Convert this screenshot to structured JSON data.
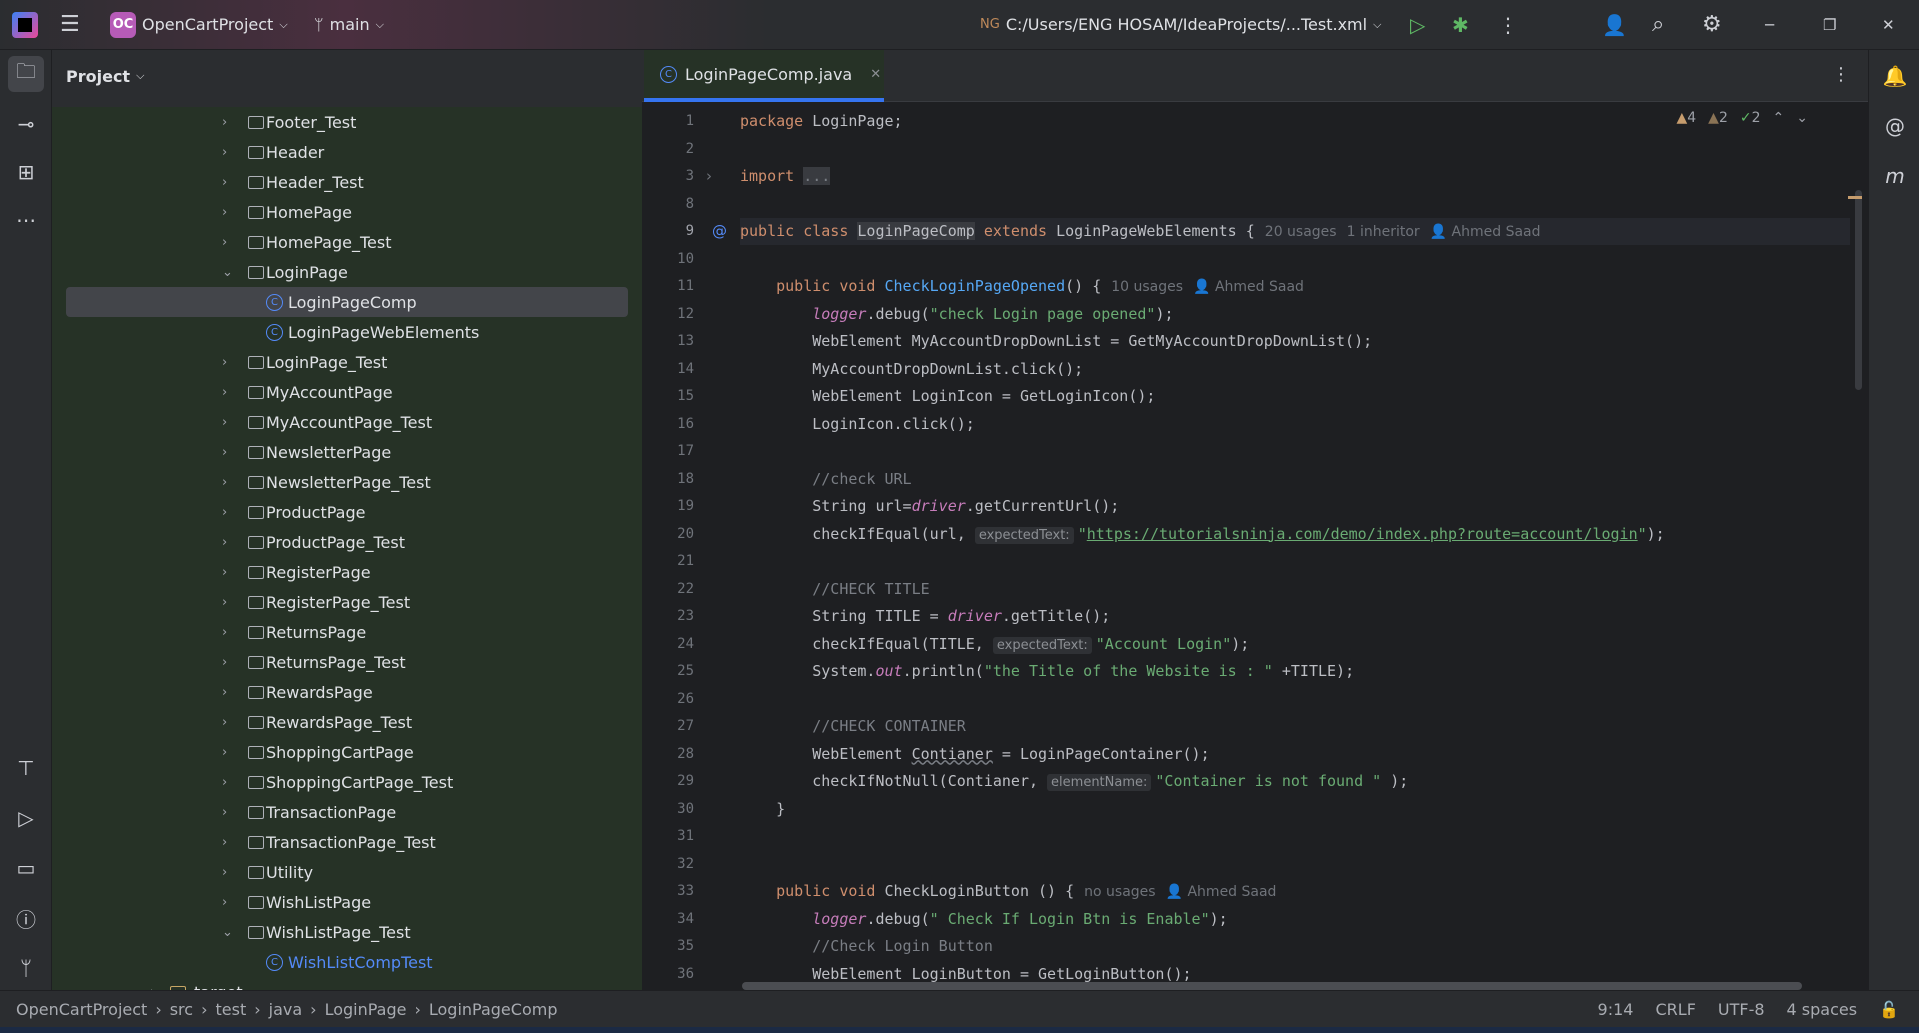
{
  "titlebar": {
    "project_badge": "OC",
    "project": "OpenCartProject",
    "branch": "main",
    "run_config": "C:/Users/ENG HOSAM/IdeaProjects/...Test.xml"
  },
  "project_panel": {
    "title": "Project",
    "items": [
      {
        "label": "Footer_Test",
        "type": "folder",
        "level": 1,
        "expanded": false
      },
      {
        "label": "Header",
        "type": "folder",
        "level": 1,
        "expanded": false
      },
      {
        "label": "Header_Test",
        "type": "folder",
        "level": 1,
        "expanded": false
      },
      {
        "label": "HomePage",
        "type": "folder",
        "level": 1,
        "expanded": false
      },
      {
        "label": "HomePage_Test",
        "type": "folder",
        "level": 1,
        "expanded": false
      },
      {
        "label": "LoginPage",
        "type": "folder",
        "level": 1,
        "expanded": true
      },
      {
        "label": "LoginPageComp",
        "type": "class",
        "level": 2,
        "selected": true
      },
      {
        "label": "LoginPageWebElements",
        "type": "class",
        "level": 2
      },
      {
        "label": "LoginPage_Test",
        "type": "folder",
        "level": 1,
        "expanded": false
      },
      {
        "label": "MyAccountPage",
        "type": "folder",
        "level": 1,
        "expanded": false
      },
      {
        "label": "MyAccountPage_Test",
        "type": "folder",
        "level": 1,
        "expanded": false
      },
      {
        "label": "NewsletterPage",
        "type": "folder",
        "level": 1,
        "expanded": false
      },
      {
        "label": "NewsletterPage_Test",
        "type": "folder",
        "level": 1,
        "expanded": false
      },
      {
        "label": "ProductPage",
        "type": "folder",
        "level": 1,
        "expanded": false
      },
      {
        "label": "ProductPage_Test",
        "type": "folder",
        "level": 1,
        "expanded": false
      },
      {
        "label": "RegisterPage",
        "type": "folder",
        "level": 1,
        "expanded": false
      },
      {
        "label": "RegisterPage_Test",
        "type": "folder",
        "level": 1,
        "expanded": false
      },
      {
        "label": "ReturnsPage",
        "type": "folder",
        "level": 1,
        "expanded": false
      },
      {
        "label": "ReturnsPage_Test",
        "type": "folder",
        "level": 1,
        "expanded": false
      },
      {
        "label": "RewardsPage",
        "type": "folder",
        "level": 1,
        "expanded": false
      },
      {
        "label": "RewardsPage_Test",
        "type": "folder",
        "level": 1,
        "expanded": false
      },
      {
        "label": "ShoppingCartPage",
        "type": "folder",
        "level": 1,
        "expanded": false
      },
      {
        "label": "ShoppingCartPage_Test",
        "type": "folder",
        "level": 1,
        "expanded": false
      },
      {
        "label": "TransactionPage",
        "type": "folder",
        "level": 1,
        "expanded": false
      },
      {
        "label": "TransactionPage_Test",
        "type": "folder",
        "level": 1,
        "expanded": false
      },
      {
        "label": "Utility",
        "type": "folder",
        "level": 1,
        "expanded": false
      },
      {
        "label": "WishListPage",
        "type": "folder",
        "level": 1,
        "expanded": false
      },
      {
        "label": "WishListPage_Test",
        "type": "folder",
        "level": 1,
        "expanded": true
      },
      {
        "label": "WishListCompTest",
        "type": "testclass",
        "level": 2
      },
      {
        "label": "target",
        "type": "plainfolder",
        "level": 0,
        "expanded": false
      }
    ]
  },
  "editor": {
    "tab": "LoginPageComp.java",
    "inspections": {
      "warnings": "4",
      "weak_warnings": "2",
      "ok": "2"
    },
    "lines": [
      {
        "n": "1",
        "t": [
          [
            "k",
            "package "
          ],
          [
            "d",
            "LoginPage;"
          ]
        ]
      },
      {
        "n": "2",
        "t": []
      },
      {
        "n": "3",
        "fold": true,
        "t": [
          [
            "k",
            "import "
          ],
          [
            "hl mg",
            "..."
          ]
        ]
      },
      {
        "n": "8",
        "t": []
      },
      {
        "n": "9",
        "cur": true,
        "t": [
          [
            "k",
            "public class "
          ],
          [
            "hl d",
            "LoginPageComp"
          ],
          [
            "k",
            " extends "
          ],
          [
            "d",
            "LoginPageWebElements {"
          ],
          [
            "hint",
            "20 usages"
          ],
          [
            "hint",
            "1 inheritor"
          ],
          [
            "hint",
            "👤 Ahmed Saad"
          ]
        ]
      },
      {
        "n": "10",
        "t": []
      },
      {
        "n": "11",
        "t": [
          [
            "d",
            "    "
          ],
          [
            "k",
            "public void "
          ],
          [
            "m",
            "CheckLoginPageOpened"
          ],
          [
            "d",
            "() {"
          ],
          [
            "hint",
            "10 usages"
          ],
          [
            "hint",
            "👤 Ahmed Saad"
          ]
        ]
      },
      {
        "n": "12",
        "t": [
          [
            "d",
            "        "
          ],
          [
            "f",
            "logger"
          ],
          [
            "d",
            ".debug("
          ],
          [
            "s",
            "\"check Login page opened\""
          ],
          [
            "d",
            ");"
          ]
        ]
      },
      {
        "n": "13",
        "t": [
          [
            "d",
            "        WebElement MyAccountDropDownList = GetMyAccountDropDownList();"
          ]
        ]
      },
      {
        "n": "14",
        "t": [
          [
            "d",
            "        MyAccountDropDownList.click();"
          ]
        ]
      },
      {
        "n": "15",
        "t": [
          [
            "d",
            "        WebElement LoginIcon = GetLoginIcon();"
          ]
        ]
      },
      {
        "n": "16",
        "t": [
          [
            "d",
            "        LoginIcon.click();"
          ]
        ]
      },
      {
        "n": "17",
        "t": []
      },
      {
        "n": "18",
        "t": [
          [
            "c",
            "        //check URL"
          ]
        ]
      },
      {
        "n": "19",
        "t": [
          [
            "d",
            "        String url="
          ],
          [
            "f",
            "driver"
          ],
          [
            "d",
            ".getCurrentUrl();"
          ]
        ]
      },
      {
        "n": "20",
        "t": [
          [
            "d",
            "        checkIfEqual(url, "
          ],
          [
            "inl",
            "expectedText:"
          ],
          [
            "s",
            "\""
          ],
          [
            "u",
            "https://tutorialsninja.com/demo/index.php?route=account/login"
          ],
          [
            "s",
            "\""
          ],
          [
            "d",
            ");"
          ]
        ]
      },
      {
        "n": "21",
        "t": []
      },
      {
        "n": "22",
        "t": [
          [
            "c",
            "        //CHECK TITLE"
          ]
        ]
      },
      {
        "n": "23",
        "t": [
          [
            "d",
            "        String TITLE = "
          ],
          [
            "f",
            "driver"
          ],
          [
            "d",
            ".getTitle();"
          ]
        ]
      },
      {
        "n": "24",
        "t": [
          [
            "d",
            "        checkIfEqual(TITLE, "
          ],
          [
            "inl",
            "expectedText:"
          ],
          [
            "s",
            "\"Account Login\""
          ],
          [
            "d",
            ");"
          ]
        ]
      },
      {
        "n": "25",
        "t": [
          [
            "d",
            "        System."
          ],
          [
            "st",
            "out"
          ],
          [
            "d",
            ".println("
          ],
          [
            "s",
            "\"the Title of the Website is : \""
          ],
          [
            "d",
            " +TITLE);"
          ]
        ]
      },
      {
        "n": "26",
        "t": []
      },
      {
        "n": "27",
        "t": [
          [
            "c",
            "        //CHECK CONTAINER"
          ]
        ]
      },
      {
        "n": "28",
        "t": [
          [
            "d",
            "        WebElement "
          ],
          [
            "d w",
            "Contianer"
          ],
          [
            "d",
            " = LoginPageContainer();"
          ]
        ]
      },
      {
        "n": "29",
        "t": [
          [
            "d",
            "        checkIfNotNull(Contianer, "
          ],
          [
            "inl",
            "elementName:"
          ],
          [
            "s",
            "\"Container is not found \""
          ],
          [
            "d",
            " );"
          ]
        ]
      },
      {
        "n": "30",
        "t": [
          [
            "d",
            "    }"
          ]
        ]
      },
      {
        "n": "31",
        "t": []
      },
      {
        "n": "32",
        "t": []
      },
      {
        "n": "33",
        "t": [
          [
            "d",
            "    "
          ],
          [
            "k",
            "public void "
          ],
          [
            "d",
            "CheckLoginButton () {"
          ],
          [
            "hint",
            "no usages"
          ],
          [
            "hint",
            "👤 Ahmed Saad"
          ]
        ]
      },
      {
        "n": "34",
        "t": [
          [
            "d",
            "        "
          ],
          [
            "f",
            "logger"
          ],
          [
            "d",
            ".debug("
          ],
          [
            "s",
            "\" Check If Login Btn is Enable\""
          ],
          [
            "d",
            ");"
          ]
        ]
      },
      {
        "n": "35",
        "t": [
          [
            "c",
            "        //Check Login Button"
          ]
        ]
      },
      {
        "n": "36",
        "t": [
          [
            "d",
            "        WebElement LoginButton = GetLoginButton();"
          ]
        ]
      }
    ]
  },
  "breadcrumb": [
    "OpenCartProject",
    "src",
    "test",
    "java",
    "LoginPage",
    "LoginPageComp"
  ],
  "status": {
    "position": "9:14",
    "line_separator": "CRLF",
    "encoding": "UTF-8",
    "indent": "4 spaces"
  }
}
